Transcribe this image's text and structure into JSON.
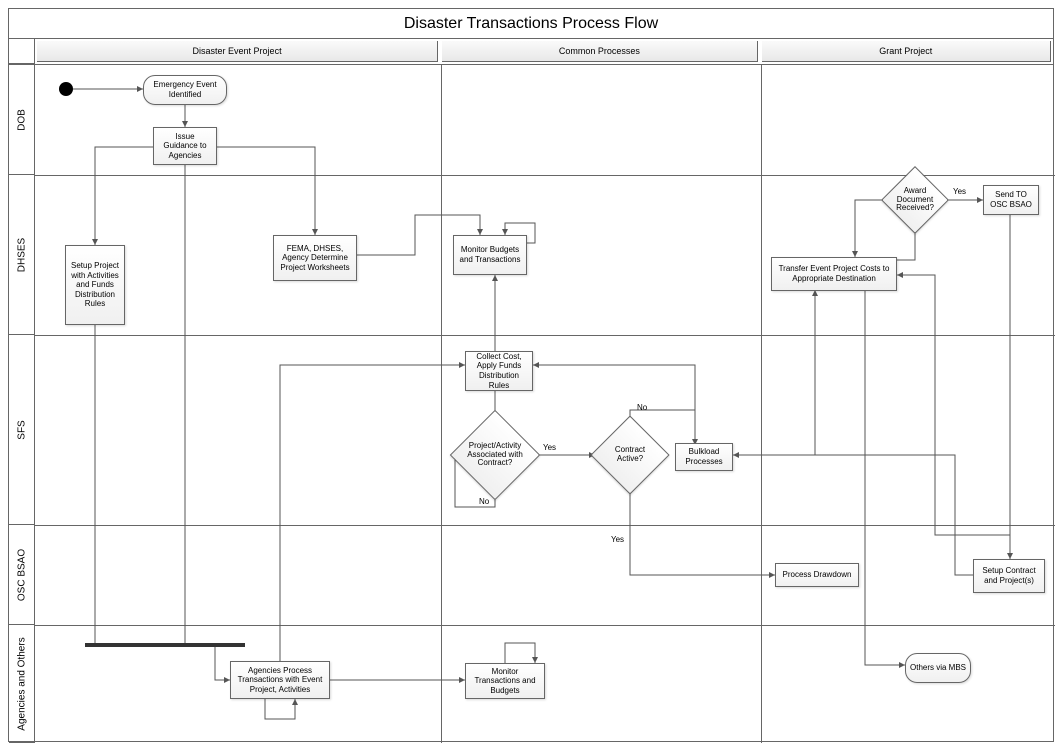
{
  "title": "Disaster Transactions Process Flow",
  "columns": [
    "Disaster Event Project",
    "Common Processes",
    "Grant Project"
  ],
  "rows": [
    "DOB",
    "DHSES",
    "SFS",
    "OSC BSAO",
    "Agencies and Others"
  ],
  "nodes": {
    "emergency_event": "Emergency Event Identified",
    "issue_guidance": "Issue Guidance to Agencies",
    "setup_project": "Setup Project with Activities and Funds Distribution Rules",
    "fema_dhses": "FEMA, DHSES, Agency Determine Project Worksheets",
    "monitor_budgets": "Monitor Budgets and Transactions",
    "award_document": "Award Document Received?",
    "send_to_osc": "Send TO OSC BSAO",
    "transfer_costs": "Transfer Event Project Costs to Appropriate Destination",
    "collect_cost": "Collect Cost, Apply Funds Distribution Rules",
    "project_activity": "Project/Activity Associated with Contract?",
    "contract_active": "Contract Active?",
    "bulkload": "Bulkload Processes",
    "process_drawdown": "Process Drawdown",
    "setup_contract": "Setup Contract and Project(s)",
    "agencies_process": "Agencies Process Transactions with Event Project, Activities",
    "monitor_trans": "Monitor Transactions and Budgets",
    "others_mbs": "Others via MBS"
  },
  "labels": {
    "yes": "Yes",
    "no": "No"
  }
}
